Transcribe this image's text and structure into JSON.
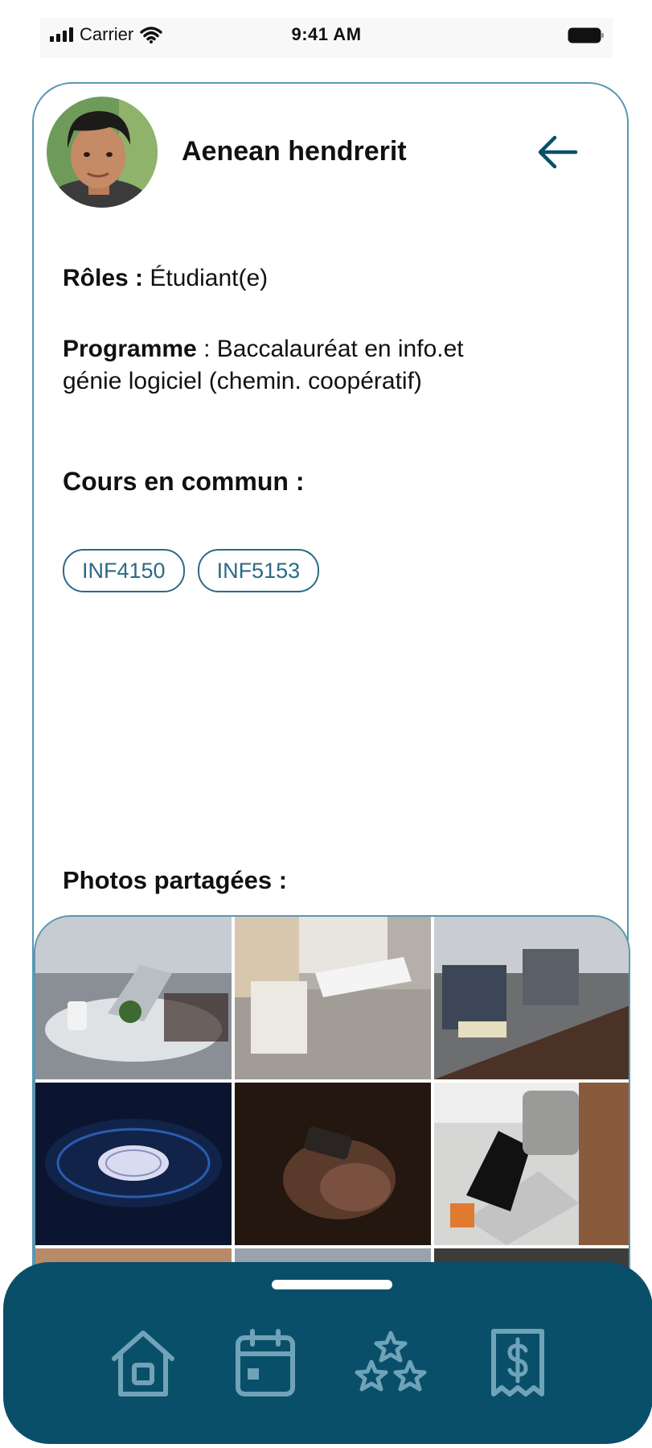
{
  "status_bar": {
    "carrier": "Carrier",
    "time": "9:41 AM"
  },
  "profile": {
    "name": "Aenean hendrerit",
    "roles_label": "Rôles :",
    "roles_value": "Étudiant(e)",
    "program_label": "Programme",
    "program_sep": " :",
    "program_value_line1": "Baccalauréat en info.et",
    "program_value_line2": "génie logiciel (chemin. coopératif)"
  },
  "courses": {
    "title": "Cours en commun :",
    "items": [
      "INF4150",
      "INF5153"
    ]
  },
  "photos": {
    "title": "Photos partagées :"
  },
  "nav": {
    "icons": [
      "home-icon",
      "calendar-icon",
      "stars-icon",
      "receipt-dollar-icon"
    ]
  },
  "colors": {
    "accent": "#2c6a86",
    "nav_bg": "#0a4f6a",
    "nav_icon": "#6fa3b8",
    "border": "#5a97b2"
  }
}
